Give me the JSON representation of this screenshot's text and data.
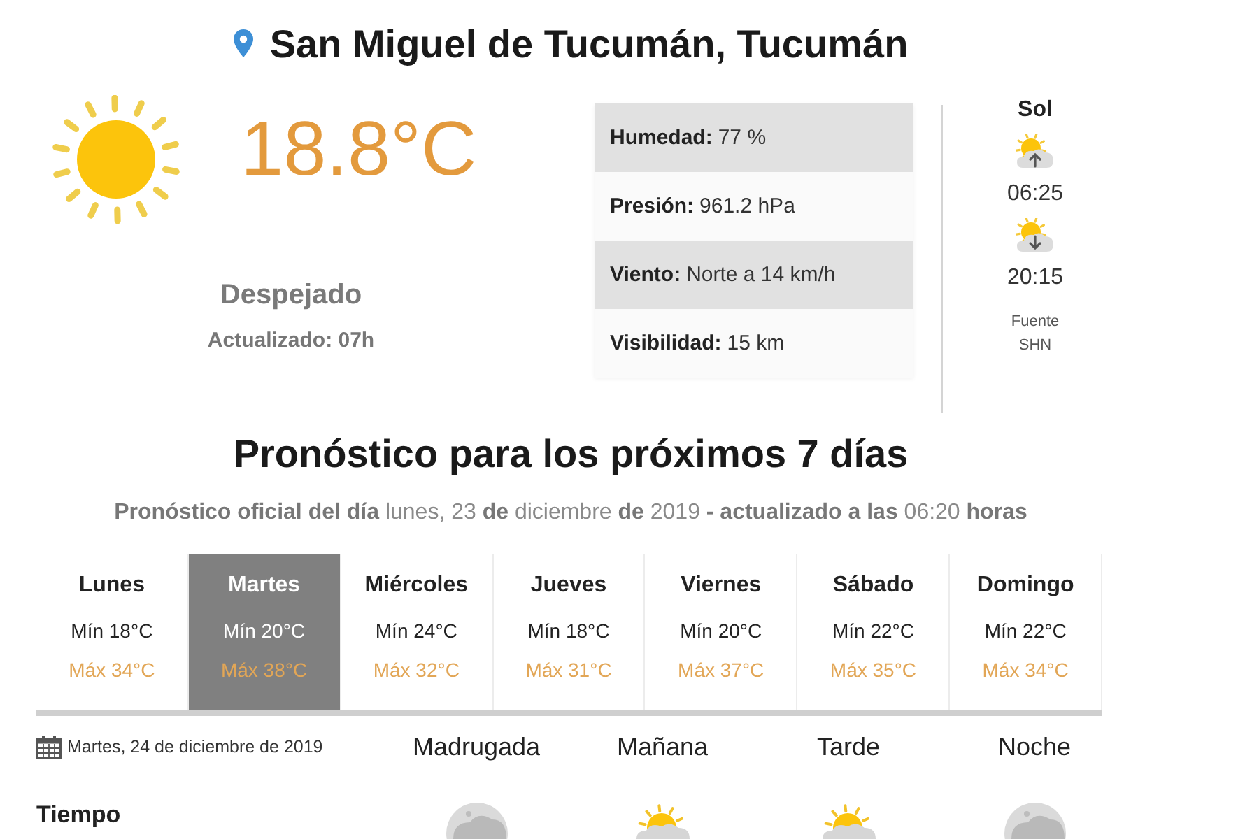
{
  "location": {
    "title": "San Miguel de Tucumán, Tucumán"
  },
  "current": {
    "temperature": "18.8°C",
    "condition": "Despejado",
    "updated": "Actualizado: 07h"
  },
  "stats": [
    {
      "label": "Humedad:",
      "value": "77 %"
    },
    {
      "label": "Presión:",
      "value": "961.2 hPa"
    },
    {
      "label": "Viento:",
      "value": "Norte a 14 km/h"
    },
    {
      "label": "Visibilidad:",
      "value": "15 km"
    }
  ],
  "sun": {
    "title": "Sol",
    "sunrise": "06:25",
    "sunset": "20:15",
    "source_label": "Fuente",
    "source_name": "SHN"
  },
  "forecast": {
    "title": "Pronóstico para los próximos 7 días",
    "subtitle": "**Pronóstico oficial del día** lunes, 23 **de** diciembre **de** 2019 **- actualizado a las** 06:20 **horas**",
    "days": [
      {
        "name": "Lunes",
        "min": "Mín 18°C",
        "max": "Máx 34°C",
        "selected": false
      },
      {
        "name": "Martes",
        "min": "Mín 20°C",
        "max": "Máx 38°C",
        "selected": true
      },
      {
        "name": "Miércoles",
        "min": "Mín 24°C",
        "max": "Máx 32°C",
        "selected": false
      },
      {
        "name": "Jueves",
        "min": "Mín 18°C",
        "max": "Máx 31°C",
        "selected": false
      },
      {
        "name": "Viernes",
        "min": "Mín 20°C",
        "max": "Máx 37°C",
        "selected": false
      },
      {
        "name": "Sábado",
        "min": "Mín 22°C",
        "max": "Máx 35°C",
        "selected": false
      },
      {
        "name": "Domingo",
        "min": "Mín 22°C",
        "max": "Máx 34°C",
        "selected": false
      }
    ]
  },
  "detail": {
    "date": "Martes, 24 de diciembre de 2019",
    "periods": [
      {
        "name": "Madrugada",
        "kind": "cloud"
      },
      {
        "name": "Mañana",
        "kind": "sun-cloud"
      },
      {
        "name": "Tarde",
        "kind": "sun-cloud"
      },
      {
        "name": "Noche",
        "kind": "cloud"
      }
    ],
    "row_label": "Tiempo"
  }
}
